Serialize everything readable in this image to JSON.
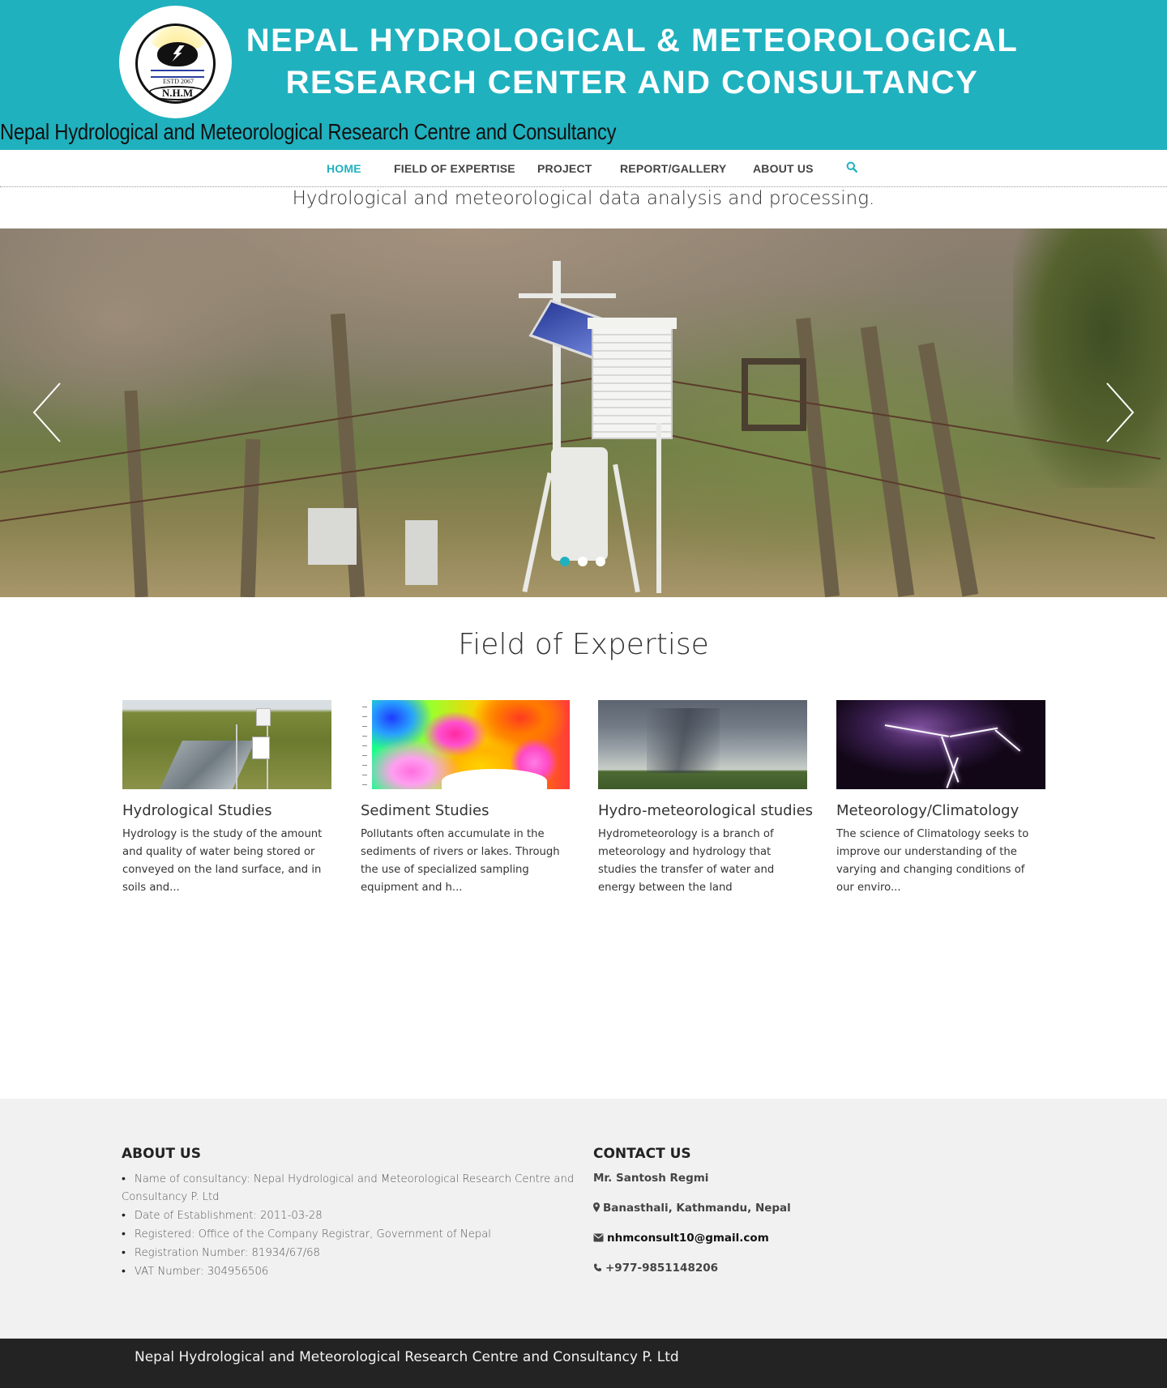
{
  "header": {
    "title_line1": "NEPAL HYDROLOGICAL & METEOROLOGICAL",
    "title_line2": "RESEARCH CENTER AND CONSULTANCY",
    "site_name": "Nepal Hydrological and Meteorological Research Centre and Consultancy",
    "logo": {
      "estd": "ESTD 2067",
      "abbr": "N.H.M"
    },
    "background_color": "#20b1bf"
  },
  "nav": {
    "items": [
      {
        "label": "HOME",
        "active": true
      },
      {
        "label": "FIELD OF EXPERTISE",
        "active": false
      },
      {
        "label": "PROJECT",
        "active": false
      },
      {
        "label": "REPORT/GALLERY",
        "active": false
      },
      {
        "label": "ABOUT US",
        "active": false
      }
    ],
    "search_icon": "search-icon",
    "accent_color": "#20b1bf"
  },
  "tagline": "Hydrological and meteorological data analysis and processing.",
  "slider": {
    "prev_icon": "chevron-left-icon",
    "next_icon": "chevron-right-icon",
    "slide_count": 3,
    "active_index": 0
  },
  "expertise": {
    "title": "Field of Expertise",
    "cards": [
      {
        "title": "Hydrological Studies",
        "text": "Hydrology is the study of the amount and quality of water being stored or conveyed on the land surface, and in soils and..."
      },
      {
        "title": "Sediment Studies",
        "text": "Pollutants often accumulate in the sediments of rivers or lakes. Through the use of specialized sampling equipment and h..."
      },
      {
        "title": "Hydro-meteorological studies",
        "text": "Hydrometeorology is a branch of meteorology and hydrology that studies the transfer of water and energy between the land"
      },
      {
        "title": "Meteorology/Climatology",
        "text": "The science of Climatology seeks to improve our understanding of the varying and changing conditions of our enviro..."
      }
    ]
  },
  "about": {
    "heading": "ABOUT US",
    "items": [
      "Name of consultancy:  Nepal Hydrological and Meteorological Research Centre and Consultancy P. Ltd",
      "Date of Establishment:  2011-03-28",
      "Registered:  Office of the Company Registrar, Government of Nepal",
      "Registration Number:  81934/67/68",
      "VAT Number:  304956506"
    ]
  },
  "contact": {
    "heading": "CONTACT US",
    "name": "Mr. Santosh Regmi",
    "address": "Banasthali, Kathmandu, Nepal",
    "email": "nhmconsult10@gmail.com",
    "phone": "+977-9851148206"
  },
  "footer": {
    "text": "Nepal Hydrological and Meteorological Research Centre and Consultancy P. Ltd"
  }
}
